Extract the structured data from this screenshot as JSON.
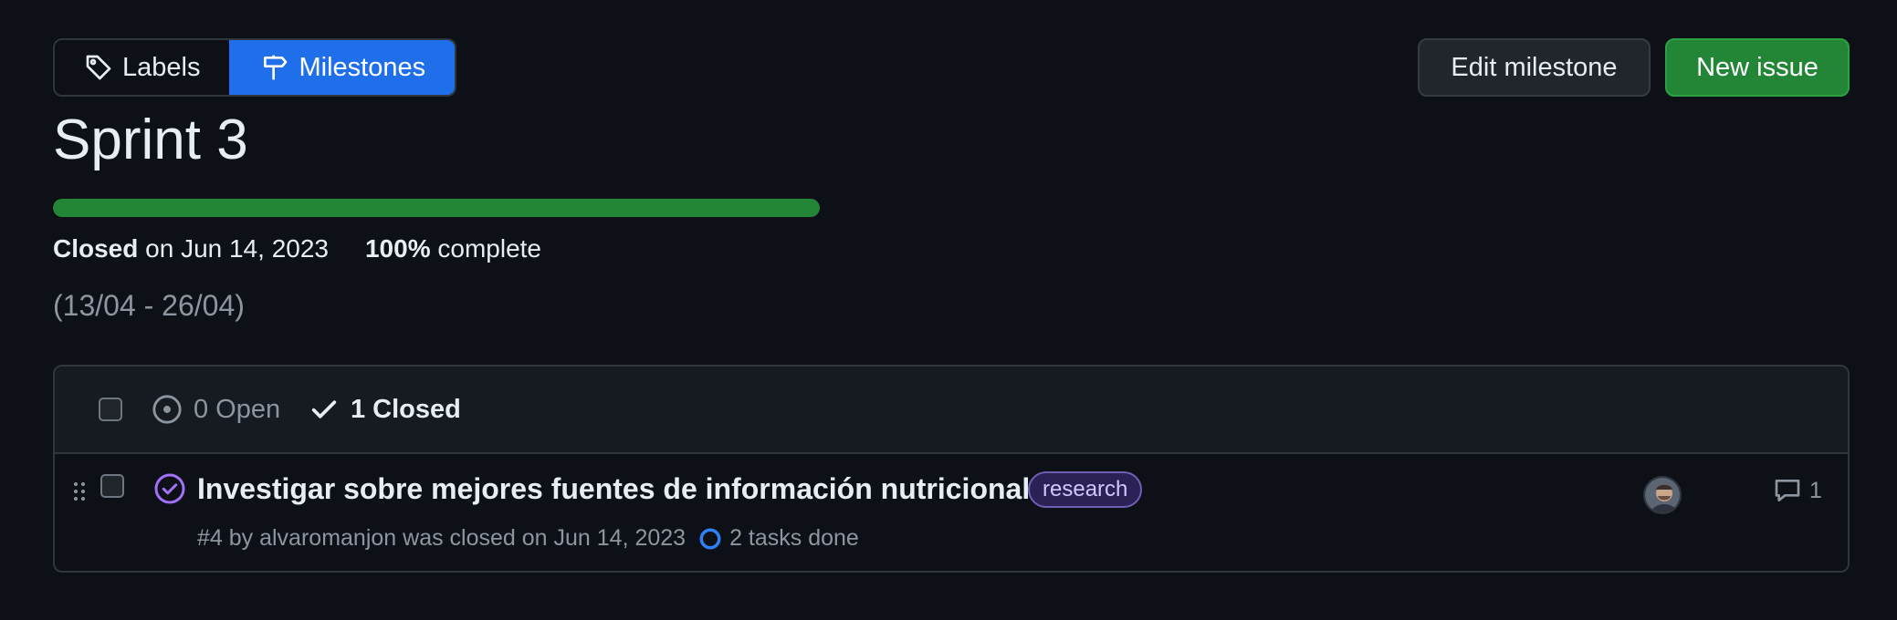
{
  "nav": {
    "labels_label": "Labels",
    "milestones_label": "Milestones"
  },
  "actions": {
    "edit_label": "Edit milestone",
    "new_issue_label": "New issue"
  },
  "milestone": {
    "title": "Sprint 3",
    "progress_fraction": 1.0,
    "closed_word": "Closed",
    "closed_date": " on Jun 14, 2023",
    "percent": "100%",
    "percent_suffix": " complete",
    "description": "(13/04 - 26/04)"
  },
  "issues_header": {
    "open_label": "0 Open",
    "closed_label": "1 Closed"
  },
  "issues": [
    {
      "title": "Investigar sobre mejores fuentes de información nutricional",
      "label": "research",
      "meta": "#4 by alvaromanjon was closed on Jun 14, 2023",
      "tasks": "2 tasks done",
      "comments": "1"
    }
  ],
  "colors": {
    "accent_blue": "#1f6feb",
    "success_green": "#238636",
    "closed_purple": "#a371f7",
    "label_bg": "#2b2155"
  },
  "icons": {
    "labels": "tag-icon",
    "milestones": "milestone-icon",
    "open": "issue-open-icon",
    "closed": "check-icon",
    "issue_state": "issue-closed-icon",
    "tasks": "task-progress-icon",
    "comments": "comment-icon"
  }
}
